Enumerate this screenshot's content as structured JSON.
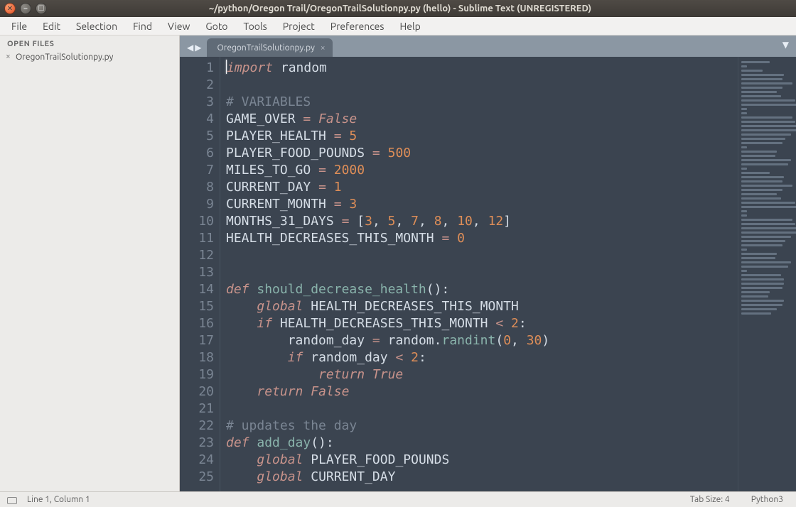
{
  "titlebar": {
    "title": "~/python/Oregon Trail/OregonTrailSolutionpy.py (hello) - Sublime Text (UNREGISTERED)"
  },
  "menu": [
    "File",
    "Edit",
    "Selection",
    "Find",
    "View",
    "Goto",
    "Tools",
    "Project",
    "Preferences",
    "Help"
  ],
  "sidebar": {
    "header": "OPEN FILES",
    "files": [
      "OregonTrailSolutionpy.py"
    ]
  },
  "tabs": {
    "active": "OregonTrailSolutionpy.py"
  },
  "code_lines": [
    [
      {
        "t": "import",
        "c": "kw"
      },
      {
        "t": " "
      },
      {
        "t": "random",
        "c": "id"
      }
    ],
    [],
    [
      {
        "t": "# VARIABLES",
        "c": "cmt"
      }
    ],
    [
      {
        "t": "GAME_OVER",
        "c": "id"
      },
      {
        "t": " "
      },
      {
        "t": "=",
        "c": "op"
      },
      {
        "t": " "
      },
      {
        "t": "False",
        "c": "bool"
      }
    ],
    [
      {
        "t": "PLAYER_HEALTH",
        "c": "id"
      },
      {
        "t": " "
      },
      {
        "t": "=",
        "c": "op"
      },
      {
        "t": " "
      },
      {
        "t": "5",
        "c": "num"
      }
    ],
    [
      {
        "t": "PLAYER_FOOD_POUNDS",
        "c": "id"
      },
      {
        "t": " "
      },
      {
        "t": "=",
        "c": "op"
      },
      {
        "t": " "
      },
      {
        "t": "500",
        "c": "num"
      }
    ],
    [
      {
        "t": "MILES_TO_GO",
        "c": "id"
      },
      {
        "t": " "
      },
      {
        "t": "=",
        "c": "op"
      },
      {
        "t": " "
      },
      {
        "t": "2000",
        "c": "num"
      }
    ],
    [
      {
        "t": "CURRENT_DAY",
        "c": "id"
      },
      {
        "t": " "
      },
      {
        "t": "=",
        "c": "op"
      },
      {
        "t": " "
      },
      {
        "t": "1",
        "c": "num"
      }
    ],
    [
      {
        "t": "CURRENT_MONTH",
        "c": "id"
      },
      {
        "t": " "
      },
      {
        "t": "=",
        "c": "op"
      },
      {
        "t": " "
      },
      {
        "t": "3",
        "c": "num"
      }
    ],
    [
      {
        "t": "MONTHS_31_DAYS",
        "c": "id"
      },
      {
        "t": " "
      },
      {
        "t": "=",
        "c": "op"
      },
      {
        "t": " ["
      },
      {
        "t": "3",
        "c": "num"
      },
      {
        "t": ", "
      },
      {
        "t": "5",
        "c": "num"
      },
      {
        "t": ", "
      },
      {
        "t": "7",
        "c": "num"
      },
      {
        "t": ", "
      },
      {
        "t": "8",
        "c": "num"
      },
      {
        "t": ", "
      },
      {
        "t": "10",
        "c": "num"
      },
      {
        "t": ", "
      },
      {
        "t": "12",
        "c": "num"
      },
      {
        "t": "]"
      }
    ],
    [
      {
        "t": "HEALTH_DECREASES_THIS_MONTH",
        "c": "id"
      },
      {
        "t": " "
      },
      {
        "t": "=",
        "c": "op"
      },
      {
        "t": " "
      },
      {
        "t": "0",
        "c": "num"
      }
    ],
    [],
    [],
    [
      {
        "t": "def",
        "c": "kw"
      },
      {
        "t": " "
      },
      {
        "t": "should_decrease_health",
        "c": "func"
      },
      {
        "t": "():",
        "c": "paren"
      }
    ],
    [
      {
        "t": "    "
      },
      {
        "t": "global",
        "c": "kw"
      },
      {
        "t": " "
      },
      {
        "t": "HEALTH_DECREASES_THIS_MONTH",
        "c": "id"
      }
    ],
    [
      {
        "t": "    "
      },
      {
        "t": "if",
        "c": "kw"
      },
      {
        "t": " "
      },
      {
        "t": "HEALTH_DECREASES_THIS_MONTH",
        "c": "id"
      },
      {
        "t": " "
      },
      {
        "t": "<",
        "c": "op"
      },
      {
        "t": " "
      },
      {
        "t": "2",
        "c": "num"
      },
      {
        "t": ":",
        "c": "paren"
      }
    ],
    [
      {
        "t": "        "
      },
      {
        "t": "random_day",
        "c": "id"
      },
      {
        "t": " "
      },
      {
        "t": "=",
        "c": "op"
      },
      {
        "t": " "
      },
      {
        "t": "random",
        "c": "id"
      },
      {
        "t": "."
      },
      {
        "t": "randint",
        "c": "call"
      },
      {
        "t": "(",
        "c": "paren"
      },
      {
        "t": "0",
        "c": "num"
      },
      {
        "t": ", "
      },
      {
        "t": "30",
        "c": "num"
      },
      {
        "t": ")",
        "c": "paren"
      }
    ],
    [
      {
        "t": "        "
      },
      {
        "t": "if",
        "c": "kw"
      },
      {
        "t": " "
      },
      {
        "t": "random_day",
        "c": "id"
      },
      {
        "t": " "
      },
      {
        "t": "<",
        "c": "op"
      },
      {
        "t": " "
      },
      {
        "t": "2",
        "c": "num"
      },
      {
        "t": ":",
        "c": "paren"
      }
    ],
    [
      {
        "t": "            "
      },
      {
        "t": "return",
        "c": "kw"
      },
      {
        "t": " "
      },
      {
        "t": "True",
        "c": "bool"
      }
    ],
    [
      {
        "t": "    "
      },
      {
        "t": "return",
        "c": "kw"
      },
      {
        "t": " "
      },
      {
        "t": "False",
        "c": "bool"
      }
    ],
    [],
    [
      {
        "t": "# updates the day",
        "c": "cmt"
      }
    ],
    [
      {
        "t": "def",
        "c": "kw"
      },
      {
        "t": " "
      },
      {
        "t": "add_day",
        "c": "func"
      },
      {
        "t": "():",
        "c": "paren"
      }
    ],
    [
      {
        "t": "    "
      },
      {
        "t": "global",
        "c": "kw"
      },
      {
        "t": " "
      },
      {
        "t": "PLAYER_FOOD_POUNDS",
        "c": "id"
      }
    ],
    [
      {
        "t": "    "
      },
      {
        "t": "global",
        "c": "kw"
      },
      {
        "t": " "
      },
      {
        "t": "CURRENT_DAY",
        "c": "id"
      }
    ]
  ],
  "statusbar": {
    "position": "Line 1, Column 1",
    "tabsize": "Tab Size: 4",
    "syntax": "Python3"
  },
  "minimap_widths": [
    40,
    8,
    30,
    60,
    58,
    72,
    58,
    50,
    56,
    76,
    78,
    8,
    8,
    72,
    76,
    78,
    78,
    70,
    62,
    58,
    8,
    50,
    48,
    70,
    66,
    8,
    40,
    60,
    58,
    72,
    58,
    50,
    56,
    76,
    78,
    8,
    8,
    72,
    76,
    78,
    78,
    70,
    62,
    58,
    8,
    50,
    48,
    70,
    66,
    8,
    56,
    60,
    60,
    58,
    40,
    38,
    60,
    58,
    50,
    42
  ]
}
